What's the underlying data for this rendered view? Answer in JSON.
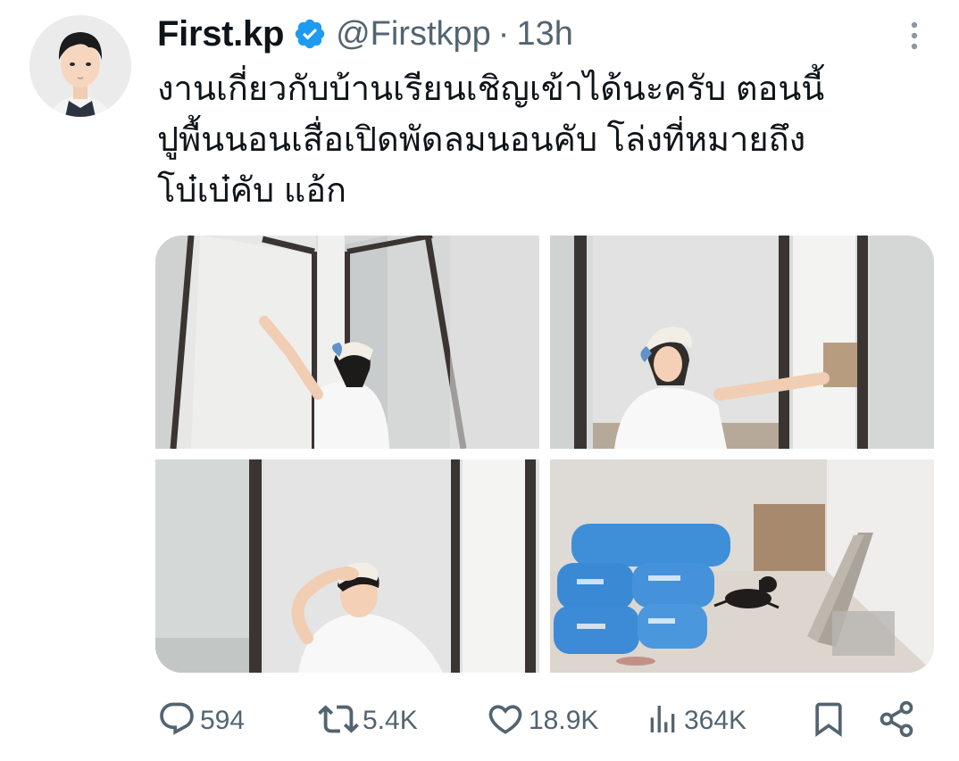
{
  "tweet": {
    "display_name": "First.kp",
    "handle": "@Firstkpp",
    "separator": "·",
    "time": "13h",
    "text_lines": [
      "งานเกี่ยวกับบ้านเรียนเชิญเข้าได้นะครับ ตอนนี้",
      "ปูพื้นนอนเสื่อเปิดพัดลมนอนคับ โล่งที่หมายถึง",
      "โบ๋เบ๋คับ แอ้ก"
    ],
    "verified_color": "#1d9bf0"
  },
  "actions": {
    "replies": "594",
    "reposts": "5.4K",
    "likes": "18.9K",
    "views": "364K"
  },
  "icons": [
    "verified-badge-icon",
    "more-icon",
    "reply-icon",
    "repost-icon",
    "like-icon",
    "views-icon",
    "bookmark-icon",
    "share-icon"
  ],
  "colors": {
    "text_primary": "#0f1419",
    "text_secondary": "#536471",
    "accent": "#1d9bf0"
  }
}
